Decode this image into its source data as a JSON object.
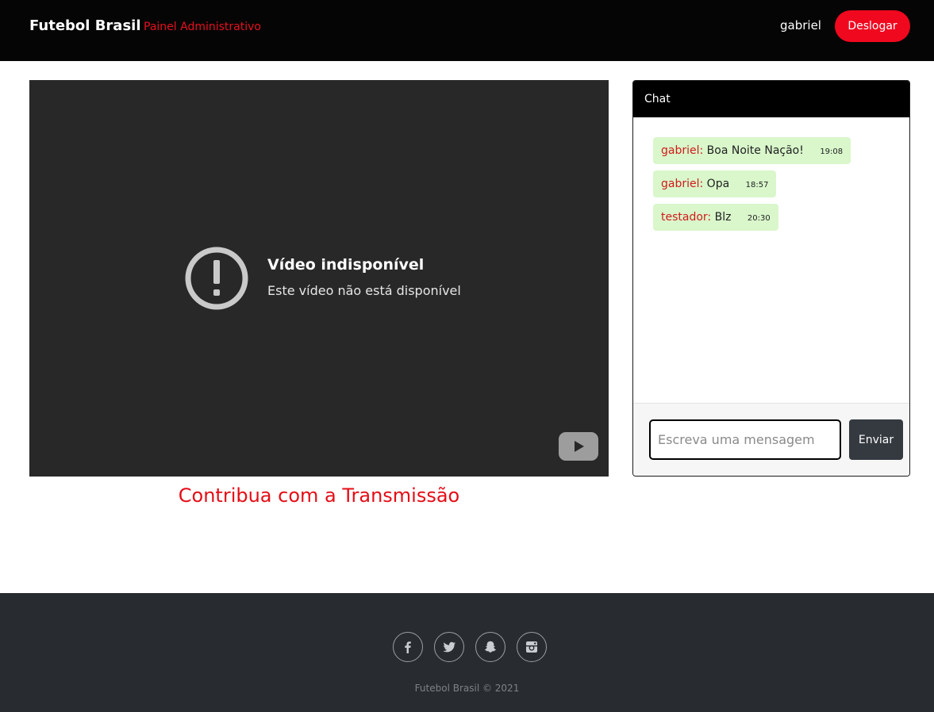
{
  "navbar": {
    "brand": "Futebol Brasil",
    "admin_link": "Painel Administrativo",
    "username": "gabriel",
    "logout_label": "Deslogar"
  },
  "video": {
    "title": "Vídeo indisponível",
    "message": "Este vídeo não está disponível"
  },
  "contribute_label": "Contribua com a Transmissão",
  "chat": {
    "title": "Chat",
    "messages": [
      {
        "author": "gabriel:",
        "text": "Boa Noite Nação!",
        "time": "19:08"
      },
      {
        "author": "gabriel:",
        "text": "Opa",
        "time": "18:57"
      },
      {
        "author": "testador:",
        "text": "Blz",
        "time": "20:30"
      }
    ],
    "input_placeholder": "Escreva uma mensagem",
    "send_label": "Enviar"
  },
  "footer": {
    "social_icons": [
      "facebook-icon",
      "twitter-icon",
      "snapchat-icon",
      "instagram-icon"
    ],
    "copyright": "Futebol Brasil © 2021"
  },
  "colors": {
    "navbar_bg": "#050505",
    "accent_red": "#f0081f",
    "chat_bubble": "#d9f7cb",
    "footer_bg": "#282c31"
  }
}
